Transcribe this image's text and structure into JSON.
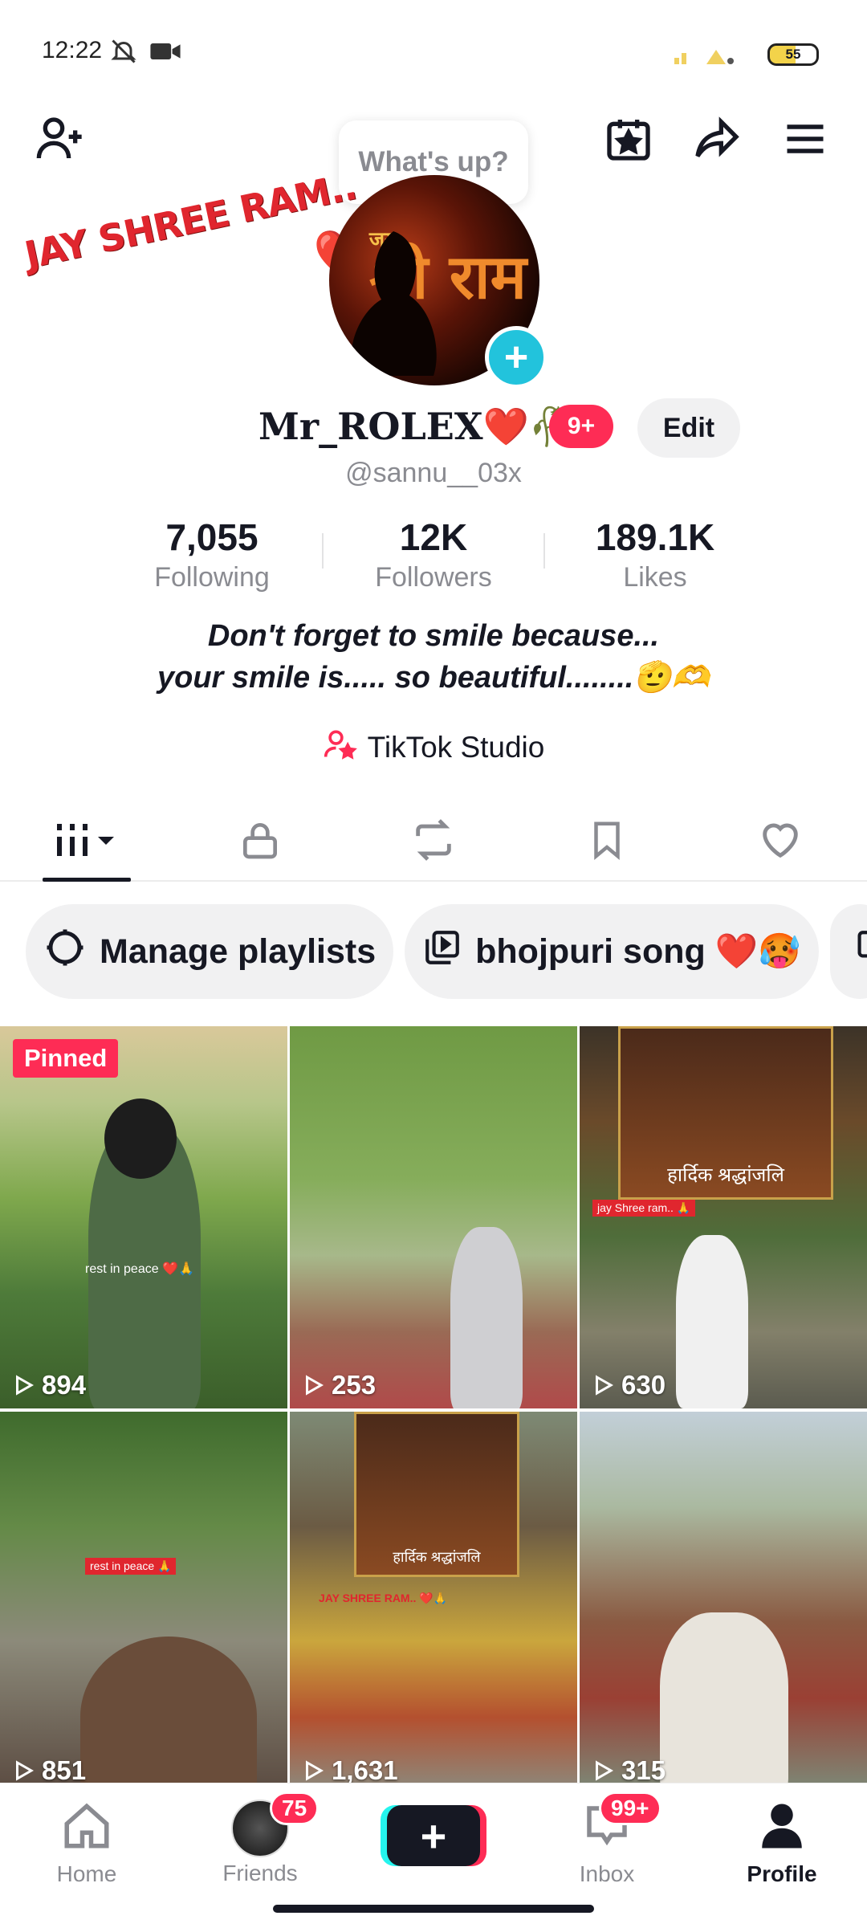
{
  "status_bar": {
    "time": "12:22",
    "battery": "55"
  },
  "top_bar": {
    "bubble_text": "What's up?"
  },
  "profile": {
    "overlay_text": "JAY SHREE RAM..",
    "avatar_text_small": "जय",
    "avatar_text_big": "श्री राम",
    "display_name": "Mr_ROLEX❤️🥀",
    "notif_badge": "9+",
    "edit_label": "Edit",
    "handle": "@sannu__03x"
  },
  "stats": [
    {
      "value": "7,055",
      "label": "Following"
    },
    {
      "value": "12K",
      "label": "Followers"
    },
    {
      "value": "189.1K",
      "label": "Likes"
    }
  ],
  "bio": {
    "line1": "Don't forget to smile because...",
    "line2": "your smile is..... so beautiful........🫡🫶"
  },
  "studio_label": "TikTok Studio",
  "chips": [
    {
      "label": "Manage playlists"
    },
    {
      "label": "bhojpuri song ❤️🥵"
    }
  ],
  "videos": [
    {
      "views": "894",
      "pinned": "Pinned",
      "caption": "rest in peace ❤️🙏"
    },
    {
      "views": "253"
    },
    {
      "views": "630",
      "poster_caption": "हार्दिक श्रद्धांजलि",
      "tag": "jay Shree ram.. 🙏"
    },
    {
      "views": "851",
      "caption": "rest in peace 🙏"
    },
    {
      "views": "1,631",
      "poster_caption": "हार्दिक श्रद्धांजलि",
      "tag": "JAY SHREE RAM.. ❤️🙏"
    },
    {
      "views": "315"
    }
  ],
  "bottom_nav": {
    "home": "Home",
    "friends": "Friends",
    "friends_badge": "75",
    "inbox": "Inbox",
    "inbox_badge": "99+",
    "profile": "Profile"
  },
  "colors": {
    "accent": "#fe2c55",
    "cyan": "#25f4ee",
    "text": "#161823",
    "muted": "#8a8b91"
  }
}
